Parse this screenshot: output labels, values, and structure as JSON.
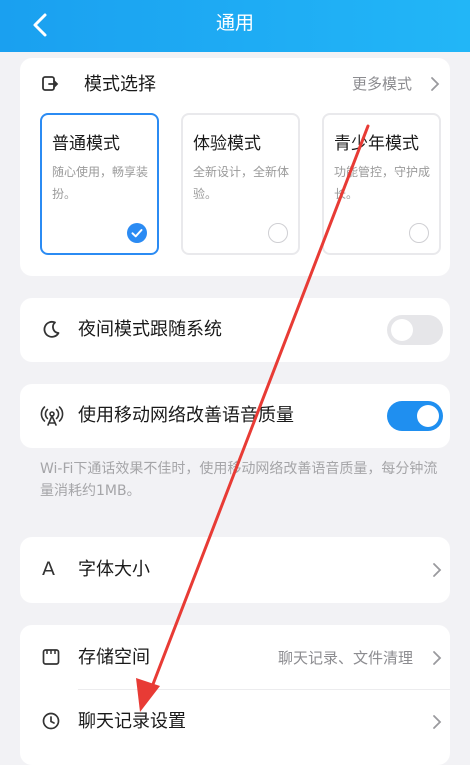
{
  "header": {
    "title": "通用"
  },
  "mode_section": {
    "title": "模式选择",
    "more_label": "更多模式",
    "modes": [
      {
        "name": "普通模式",
        "desc": "随心使用，畅享装扮。",
        "selected": true
      },
      {
        "name": "体验模式",
        "desc": "全新设计，全新体验。",
        "selected": false
      },
      {
        "name": "青少年模式",
        "desc": "功能管控，守护成长。",
        "selected": false
      }
    ]
  },
  "night_mode": {
    "label": "夜间模式跟随系统",
    "on": false
  },
  "mobile_network": {
    "label": "使用移动网络改善语音质量",
    "on": true,
    "note": "Wi-Fi下通话效果不佳时，使用移动网络改善语音质量，每分钟流量消耗约1MB。"
  },
  "font_size": {
    "label": "字体大小"
  },
  "storage": {
    "label": "存储空间",
    "value": "聊天记录、文件清理"
  },
  "chat_history": {
    "label": "聊天记录设置"
  },
  "colors": {
    "header": "#1aa0f0",
    "accent": "#2b8bf3",
    "annotation_arrow": "#e83b35"
  }
}
